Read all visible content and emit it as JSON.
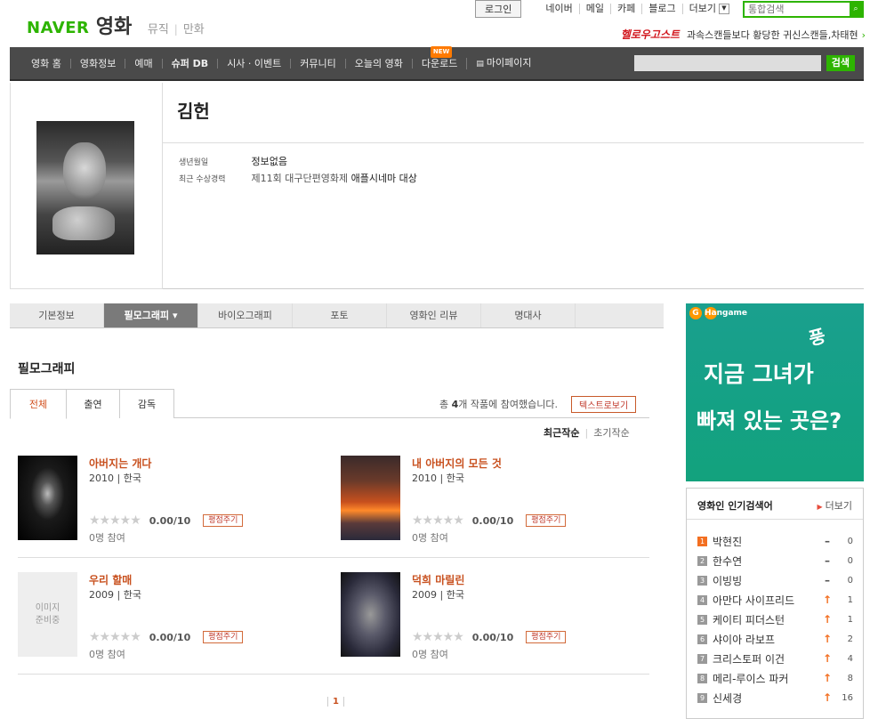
{
  "header": {
    "brand": "NAVER",
    "section": "영화",
    "sub_links": [
      "뮤직",
      "만화"
    ],
    "login_label": "로그인",
    "top_links": [
      "네이버",
      "메일",
      "카페",
      "블로그",
      "더보기"
    ],
    "search_placeholder": "통합검색",
    "ad_brand": "헬로우고스트",
    "ad_text": "과속스캔들보다 황당한 귀신스캔들,차태현"
  },
  "nav": {
    "items": [
      "영화 홈",
      "영화정보",
      "예매",
      "슈퍼 DB",
      "시사 · 이벤트",
      "커뮤니티",
      "오늘의 영화",
      "다운로드",
      "마이페이지"
    ],
    "new_badge": "NEW",
    "search_button": "검색"
  },
  "profile": {
    "name": "김헌",
    "birth_label": "생년월일",
    "birth_value": "정보없음",
    "award_label": "최근 수상경력",
    "award_value": "제11회 대구단편영화제 ",
    "award_highlight": "애플시네마 대상"
  },
  "tabs": [
    "기본정보",
    "필모그래피 ▾",
    "바이오그래피",
    "포토",
    "영화인 리뷰",
    "명대사"
  ],
  "filmography": {
    "title": "필모그래피",
    "subtabs": [
      "전체",
      "출연",
      "감독"
    ],
    "count_prefix": "총 ",
    "count_value": "4",
    "count_suffix": "개 작품에 참여했습니다.",
    "text_view_button": "텍스트로보기",
    "sort_recent": "최근작순",
    "sort_early": "초기작순",
    "rate_button": "평점주기",
    "films": [
      {
        "title": "아버지는 개다",
        "meta": "2010 | 한국",
        "score": "0.00/10",
        "count": "0명 참여"
      },
      {
        "title": "내 아버지의 모든 것",
        "meta": "2010 | 한국",
        "score": "0.00/10",
        "count": "0명 참여"
      },
      {
        "title": "우리 할매",
        "meta": "2009 | 한국",
        "score": "0.00/10",
        "count": "0명 참여",
        "placeholder": "이미지\n준비중"
      },
      {
        "title": "덕희 마릴린",
        "meta": "2009 | 한국",
        "score": "0.00/10",
        "count": "0명 참여"
      }
    ],
    "page": "1"
  },
  "ad": {
    "logo": "Hangame",
    "line1": "지금 그녀가",
    "line2": "빠져 있는 곳은?",
    "poom": "풍"
  },
  "popular": {
    "title": "영화인 인기검색어",
    "more": "더보기",
    "items": [
      {
        "rank": "1",
        "name": "박현진",
        "trend": "–",
        "change": "0"
      },
      {
        "rank": "2",
        "name": "한수연",
        "trend": "–",
        "change": "0"
      },
      {
        "rank": "3",
        "name": "이빙빙",
        "trend": "–",
        "change": "0"
      },
      {
        "rank": "4",
        "name": "아만다 사이프리드",
        "trend": "↑",
        "change": "1"
      },
      {
        "rank": "5",
        "name": "케이티 피더스턴",
        "trend": "↑",
        "change": "1"
      },
      {
        "rank": "6",
        "name": "샤이아 라보프",
        "trend": "↑",
        "change": "2"
      },
      {
        "rank": "7",
        "name": "크리스토퍼 이건",
        "trend": "↑",
        "change": "4"
      },
      {
        "rank": "8",
        "name": "메리-루이스 파커",
        "trend": "↑",
        "change": "8"
      },
      {
        "rank": "9",
        "name": "신세경",
        "trend": "↑",
        "change": "16"
      }
    ]
  }
}
